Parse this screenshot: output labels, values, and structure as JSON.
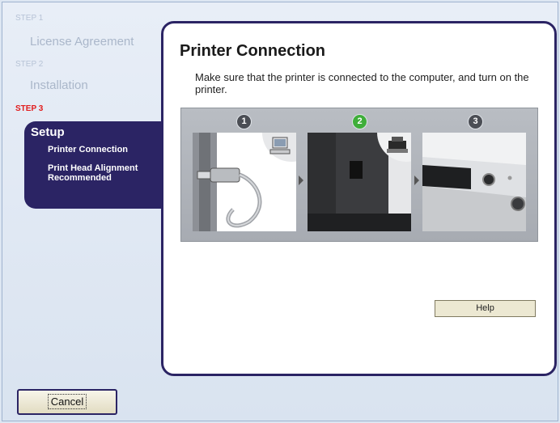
{
  "sidebar": {
    "steps": [
      {
        "label": "STEP 1",
        "title": "License Agreement"
      },
      {
        "label": "STEP 2",
        "title": "Installation"
      },
      {
        "label": "STEP 3",
        "title": "Setup"
      }
    ],
    "sub_items": [
      "Printer Connection",
      "Print Head Alignment Recommended"
    ]
  },
  "panel": {
    "title": "Printer Connection",
    "description": "Make sure that the printer is connected to the computer, and turn on the printer.",
    "diagram_steps": [
      "1",
      "2",
      "3"
    ],
    "active_step": "2"
  },
  "buttons": {
    "help": "Help",
    "cancel": "Cancel"
  },
  "colors": {
    "accent_navy": "#2b2464",
    "step_active_red": "#e11b1b",
    "active_green": "#3fae3a"
  }
}
